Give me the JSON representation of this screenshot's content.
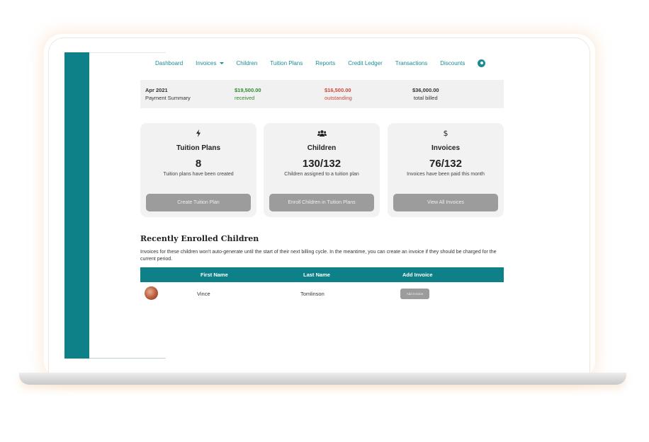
{
  "nav": {
    "items": [
      {
        "label": "Dashboard"
      },
      {
        "label": "Invoices"
      },
      {
        "label": "Children"
      },
      {
        "label": "Tuition Plans"
      },
      {
        "label": "Reports"
      },
      {
        "label": "Credit Ledger"
      },
      {
        "label": "Transactions"
      },
      {
        "label": "Discounts"
      }
    ]
  },
  "summary": {
    "period": "Apr 2021",
    "period_label": "Payment Summary",
    "received_amount": "$19,500.00",
    "received_label": "received",
    "outstanding_amount": "$16,500.00",
    "outstanding_label": "outstanding",
    "billed_amount": "$36,000.00",
    "billed_label": "total billed"
  },
  "cards": [
    {
      "icon": "lightning-bolt-icon",
      "title": "Tuition Plans",
      "value": "8",
      "desc": "Tuition plans have been created",
      "button": "Create Tuition Plan"
    },
    {
      "icon": "users-icon",
      "title": "Children",
      "value": "130/132",
      "desc": "Children assigned to a tuition plan",
      "button": "Enroll Children in Tuition Plans"
    },
    {
      "icon": "dollar-icon",
      "title": "Invoices",
      "value": "76/132",
      "desc": "Invoices have been paid this month",
      "button": "View All Invoices"
    }
  ],
  "recent": {
    "title": "Recently Enrolled Children",
    "description": "Invoices for these children won't auto-generate until the start of their next billing cycle. In the meantime, you can create an invoice if they should be charged for the current period.",
    "columns": {
      "first_name": "First Name",
      "last_name": "Last Name",
      "add_invoice": "Add Invoice"
    },
    "rows": [
      {
        "first_name": "Vince",
        "last_name": "Tomlinson",
        "button": "Add Invoice"
      }
    ]
  },
  "colors": {
    "accent": "#0e8087",
    "link": "#1c8c94",
    "received": "#2f8a2f",
    "outstanding": "#d0453a",
    "button": "#9c9c9c"
  }
}
